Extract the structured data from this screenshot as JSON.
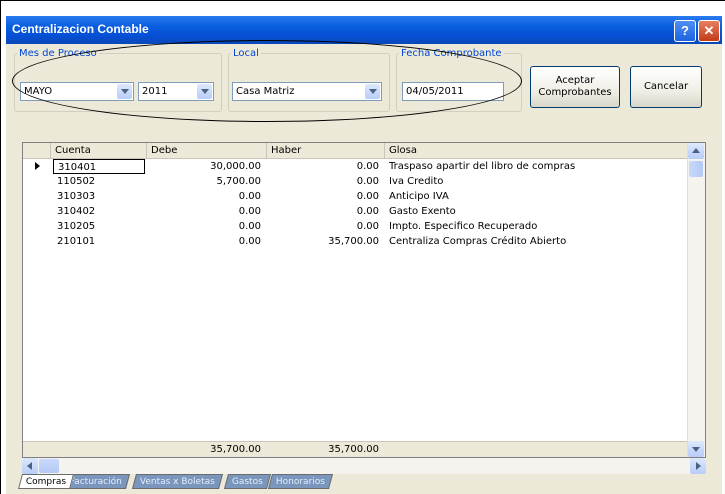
{
  "window": {
    "title": "Centralizacion Contable"
  },
  "controls": {
    "mes_legend": "Mes de Proceso",
    "mes_value": "MAYO",
    "year_value": "2011",
    "local_legend": "Local",
    "local_value": "Casa Matriz",
    "fecha_legend": "Fecha Comprobante",
    "fecha_value": "04/05/2011",
    "aceptar_label_1": "Aceptar",
    "aceptar_label_2": "Comprobantes",
    "cancelar_label": "Cancelar"
  },
  "grid": {
    "columns": [
      "Cuenta",
      "Debe",
      "Haber",
      "Glosa"
    ],
    "rows": [
      {
        "cuenta": "310401",
        "debe": "30,000.00",
        "haber": "0.00",
        "glosa": "Traspaso apartir del libro de compras"
      },
      {
        "cuenta": "110502",
        "debe": "5,700.00",
        "haber": "0.00",
        "glosa": "Iva Credito"
      },
      {
        "cuenta": "310303",
        "debe": "0.00",
        "haber": "0.00",
        "glosa": "Anticipo IVA"
      },
      {
        "cuenta": "310402",
        "debe": "0.00",
        "haber": "0.00",
        "glosa": "Gasto Exento"
      },
      {
        "cuenta": "310205",
        "debe": "0.00",
        "haber": "0.00",
        "glosa": "Impto. Especifico Recuperado"
      },
      {
        "cuenta": "210101",
        "debe": "0.00",
        "haber": "35,700.00",
        "glosa": "Centraliza Compras Crédito Abierto"
      }
    ],
    "totals": {
      "debe": "35,700.00",
      "haber": "35,700.00"
    }
  },
  "tabs": [
    "Compras",
    "Facturación",
    "Ventas x Boletas",
    "Gastos",
    "Honorarios"
  ],
  "colors": {
    "titlebar": "#0550d6",
    "legend": "#0046d5",
    "inactive_tab": "#7a96bd"
  }
}
